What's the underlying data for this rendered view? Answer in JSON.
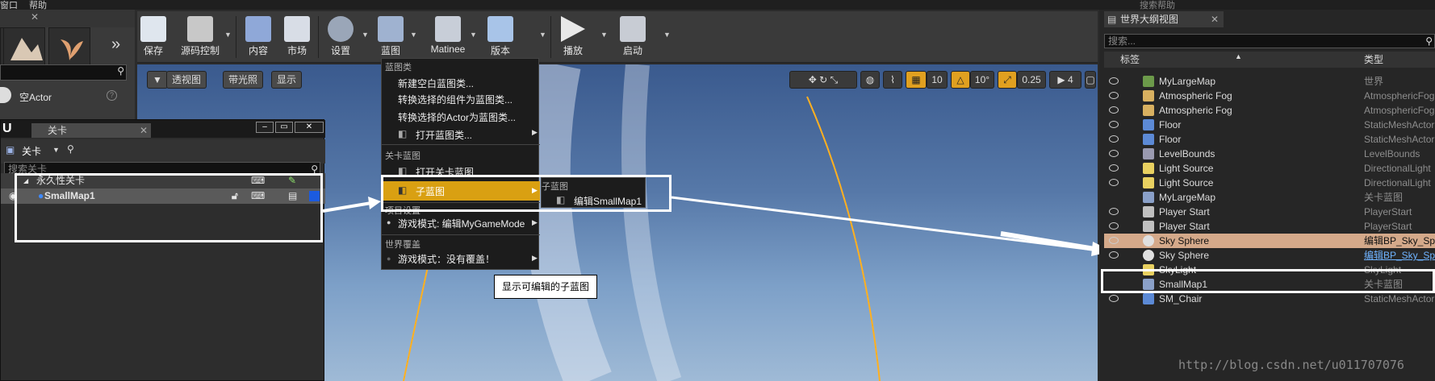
{
  "menubar": {
    "left_text": "窗口",
    "help": "帮助",
    "search_help": "搜索帮助"
  },
  "toolbar": {
    "buttons": [
      {
        "label": "保存",
        "icon": "save-icon"
      },
      {
        "label": "源码控制",
        "icon": "source-control-icon"
      },
      {
        "label": "内容",
        "icon": "content-icon"
      },
      {
        "label": "市场",
        "icon": "marketplace-icon"
      },
      {
        "label": "设置",
        "icon": "settings-icon"
      },
      {
        "label": "蓝图",
        "icon": "blueprint-icon"
      },
      {
        "label": "Matinee",
        "icon": "matinee-icon"
      },
      {
        "label": "版本",
        "icon": "build-icon"
      },
      {
        "label": "播放",
        "icon": "play-icon"
      },
      {
        "label": "启动",
        "icon": "launch-icon"
      }
    ]
  },
  "left_panel": {
    "actor_label": "空Actor"
  },
  "viewport": {
    "perspective": "透视图",
    "lit": "带光照",
    "show": "显示",
    "grid_value": "10",
    "rotation_value": "10°",
    "scale_value": "0.25",
    "camera_speed": "4"
  },
  "levels_window": {
    "tab_title": "关卡",
    "dropdown_label": "关卡",
    "search_placeholder": "搜索关卡",
    "rows": [
      {
        "name": "永久性关卡"
      },
      {
        "name": "SmallMap1"
      }
    ]
  },
  "blueprint_menu": {
    "section1": "蓝图类",
    "items1": [
      "新建空白蓝图类...",
      "转换选择的组件为蓝图类...",
      "转换选择的Actor为蓝图类...",
      "打开蓝图类..."
    ],
    "section2": "关卡蓝图",
    "items2": [
      "打开关卡蓝图",
      "子蓝图"
    ],
    "section3": "项目设置",
    "items3": [
      "游戏模式: 编辑MyGameMode"
    ],
    "section4": "世界覆盖",
    "items4": [
      "游戏模式：没有覆盖！"
    ]
  },
  "submenu": {
    "heading": "子蓝图",
    "item": "编辑SmallMap1"
  },
  "tooltip": "显示可编辑的子蓝图",
  "outliner": {
    "tab_title": "世界大纲视图",
    "search_placeholder": "搜索...",
    "col_label": "标签",
    "col_type": "类型",
    "rows": [
      {
        "label": "MyLargeMap",
        "type": "世界",
        "icon": "world-icon",
        "color": "#6c9a4a"
      },
      {
        "label": "Atmospheric Fog",
        "type": "AtmosphericFog",
        "icon": "fog-icon",
        "color": "#d8b060"
      },
      {
        "label": "Atmospheric Fog",
        "type": "AtmosphericFog",
        "icon": "fog-icon",
        "color": "#d8b060"
      },
      {
        "label": "Floor",
        "type": "StaticMeshActor",
        "icon": "static-mesh-icon",
        "color": "#5c8ad6"
      },
      {
        "label": "Floor",
        "type": "StaticMeshActor",
        "icon": "static-mesh-icon",
        "color": "#5c8ad6"
      },
      {
        "label": "LevelBounds",
        "type": "LevelBounds",
        "icon": "level-bounds-icon",
        "color": "#9a9ab0"
      },
      {
        "label": "Light Source",
        "type": "DirectionalLight",
        "icon": "light-icon",
        "color": "#e8d060"
      },
      {
        "label": "Light Source",
        "type": "DirectionalLight",
        "icon": "light-icon",
        "color": "#e8d060"
      },
      {
        "label": "MyLargeMap",
        "type": "关卡蓝图",
        "icon": "level-blueprint-icon",
        "color": "#8aa0c8"
      },
      {
        "label": "Player Start",
        "type": "PlayerStart",
        "icon": "player-start-icon",
        "color": "#c0c0c0"
      },
      {
        "label": "Player Start",
        "type": "PlayerStart",
        "icon": "player-start-icon",
        "color": "#c0c0c0"
      },
      {
        "label": "Sky Sphere",
        "type": "编辑BP_Sky_Sphere",
        "icon": "sphere-icon",
        "color": "#e0e0e0"
      },
      {
        "label": "Sky Sphere",
        "type": "编辑BP_Sky_Sphere",
        "icon": "sphere-icon",
        "color": "#e0e0e0"
      },
      {
        "label": "SkyLight",
        "type": "SkyLight",
        "icon": "skylight-icon",
        "color": "#e8d060"
      },
      {
        "label": "SmallMap1",
        "type": "关卡蓝图",
        "icon": "level-blueprint-icon",
        "color": "#8aa0c8"
      },
      {
        "label": "SM_Chair",
        "type": "StaticMeshActor",
        "icon": "static-mesh-icon",
        "color": "#5c8ad6"
      }
    ]
  },
  "watermark": "http://blog.csdn.net/u011707076",
  "colors": {
    "accent": "#e0a020",
    "selection": "#d4a98a",
    "link": "#6fb3ff"
  }
}
